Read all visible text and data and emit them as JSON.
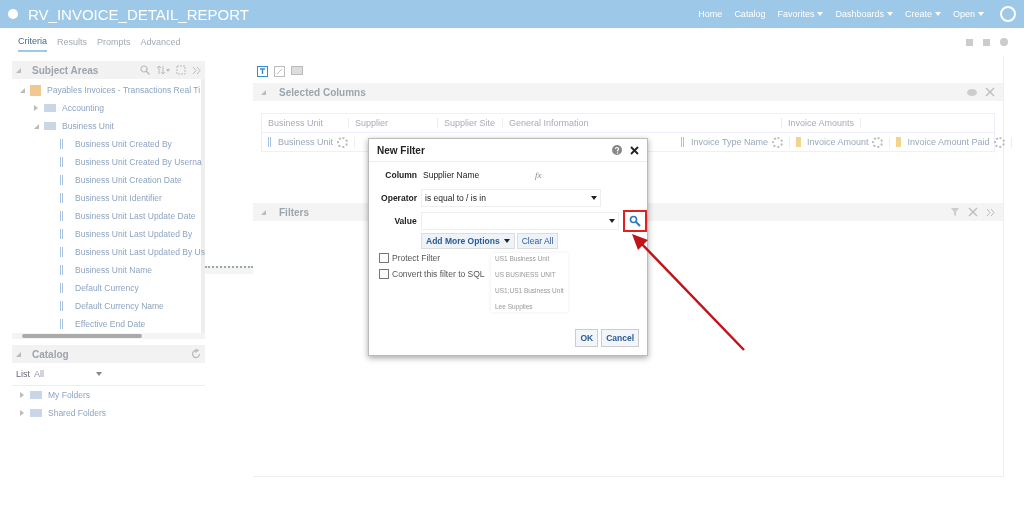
{
  "window": {
    "title": "RV_INVOICE_DETAIL_REPORT"
  },
  "nav": [
    {
      "label": "Home",
      "menu": false
    },
    {
      "label": "Catalog",
      "menu": false
    },
    {
      "label": "Favorites",
      "menu": true
    },
    {
      "label": "Dashboards",
      "menu": true
    },
    {
      "label": "Create",
      "menu": true
    },
    {
      "label": "Open",
      "menu": true
    }
  ],
  "tabs": [
    {
      "label": "Criteria",
      "selected": true
    },
    {
      "label": "Results",
      "selected": false
    },
    {
      "label": "Prompts",
      "selected": false
    },
    {
      "label": "Advanced",
      "selected": false
    }
  ],
  "subject_areas": {
    "title": "Subject Areas",
    "tree": [
      {
        "label": "Payables Invoices - Transactions Real Ti",
        "kind": "area",
        "expanded": true,
        "children": [
          {
            "label": "Accounting",
            "kind": "folder",
            "expanded": false
          },
          {
            "label": "Business Unit",
            "kind": "folder",
            "expanded": true,
            "children": [
              {
                "label": "Business Unit Created By",
                "kind": "column"
              },
              {
                "label": "Business Unit Created By Userna",
                "kind": "column"
              },
              {
                "label": "Business Unit Creation Date",
                "kind": "column"
              },
              {
                "label": "Business Unit Identifier",
                "kind": "column"
              },
              {
                "label": "Business Unit Last Update Date",
                "kind": "column"
              },
              {
                "label": "Business Unit Last Updated By",
                "kind": "column"
              },
              {
                "label": "Business Unit Last Updated By Us",
                "kind": "column"
              },
              {
                "label": "Business Unit Name",
                "kind": "column"
              },
              {
                "label": "Default Currency",
                "kind": "column"
              },
              {
                "label": "Default Currency Name",
                "kind": "column"
              },
              {
                "label": "Effective End Date",
                "kind": "column"
              }
            ]
          }
        ]
      }
    ]
  },
  "catalog": {
    "title": "Catalog",
    "list_label": "List",
    "list_value": "All",
    "folders": [
      {
        "label": "My Folders"
      },
      {
        "label": "Shared Folders"
      }
    ]
  },
  "selected_columns": {
    "title": "Selected Columns",
    "groups": [
      {
        "label": "Business Unit"
      },
      {
        "label": "Supplier"
      },
      {
        "label": "Supplier Site"
      },
      {
        "label": "General Information"
      },
      {
        "label": "Invoice Amounts"
      }
    ],
    "columns": [
      {
        "label": "Business Unit",
        "kind": "attribute"
      },
      {
        "label": "Invoice Type Name",
        "kind": "attribute"
      },
      {
        "label": "Invoice Amount",
        "kind": "measure"
      },
      {
        "label": "Invoice Amount Paid",
        "kind": "measure"
      }
    ]
  },
  "filters": {
    "title": "Filters"
  },
  "dialog": {
    "title": "New Filter",
    "column_label": "Column",
    "column_value": "Supplier Name",
    "fx": "fx",
    "operator_label": "Operator",
    "operator_value": "is equal to / is in",
    "value_label": "Value",
    "add_more": "Add More Options",
    "clear_all": "Clear All",
    "suggestions": [
      "US1 Business Unit",
      "US BUSINESS UNIT",
      "US1:US1 Business Unit",
      "Lee Supplies"
    ],
    "checkboxes": [
      {
        "label": "Protect Filter",
        "checked": false
      },
      {
        "label": "Convert this filter to SQL",
        "checked": false
      }
    ],
    "ok": "OK",
    "cancel": "Cancel"
  }
}
